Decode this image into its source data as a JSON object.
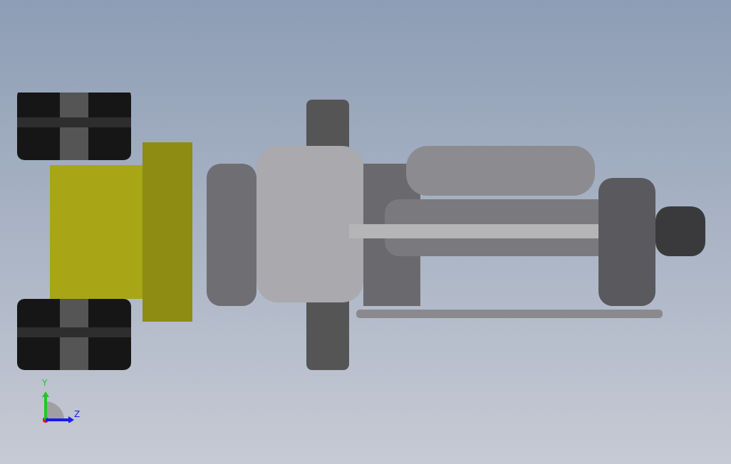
{
  "viewport": {
    "triad": {
      "axes": [
        {
          "label": "Y",
          "color": "#22c822"
        },
        {
          "label": "Z",
          "color": "#1a1aee"
        }
      ]
    }
  }
}
